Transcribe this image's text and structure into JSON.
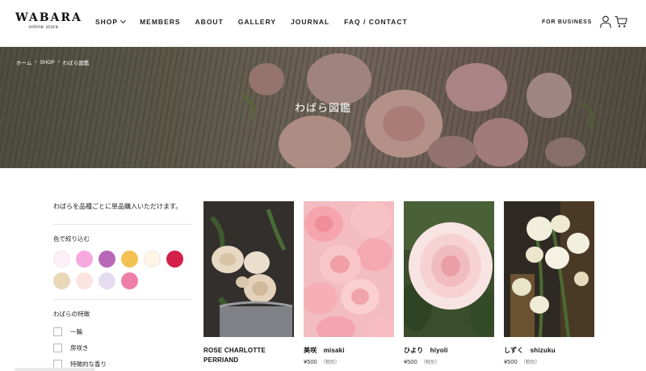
{
  "header": {
    "logo_main": "WABARA",
    "logo_sub": "online store",
    "nav": [
      {
        "label": "SHOP",
        "dropdown": true
      },
      {
        "label": "MEMBERS"
      },
      {
        "label": "ABOUT"
      },
      {
        "label": "GALLERY"
      },
      {
        "label": "JOURNAL"
      },
      {
        "label": "FAQ / CONTACT"
      }
    ],
    "business_label": "FOR BUSINESS",
    "icons": [
      "user-icon",
      "cart-icon"
    ]
  },
  "hero": {
    "breadcrumb": [
      "ホーム",
      "SHOP",
      "わばら図鑑"
    ],
    "title": "わばら図鑑"
  },
  "sidebar": {
    "intro": "わばらを品種ごとに単品購入いただけます。",
    "color_filter_title": "色で絞り込む",
    "swatches": [
      "#fdf0f6",
      "#f7a9df",
      "#b868b8",
      "#f2c150",
      "#fdf6e4",
      "#d42048",
      "#e8d8b8",
      "#fbe4e0",
      "#e6dcef",
      "#ee7fa6"
    ],
    "feature_title": "わばらの特徴",
    "features": [
      "一輪",
      "房咲き",
      "特徴的な香り"
    ]
  },
  "products": [
    {
      "name_line1": "ROSE CHARLOTTE",
      "name_line2": "PERRIAND",
      "price": "",
      "tax": ""
    },
    {
      "name_line1": "美咲　misaki",
      "name_line2": "",
      "price": "¥500",
      "tax": "（税別）"
    },
    {
      "name_line1": "ひより　hiyoli",
      "name_line2": "",
      "price": "¥500",
      "tax": "（税別）"
    },
    {
      "name_line1": "しずく　shizuku",
      "name_line2": "",
      "price": "¥500",
      "tax": "（税別）"
    }
  ]
}
